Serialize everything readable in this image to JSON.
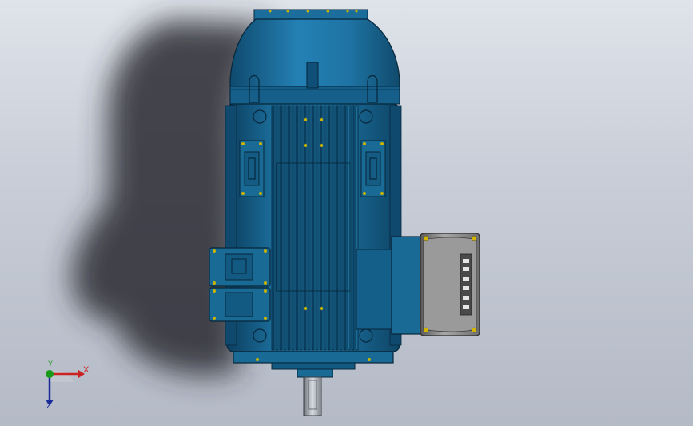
{
  "viewport": {
    "background_top": "#dfe3ea",
    "background_bottom": "#b4bac6"
  },
  "model": {
    "body_color": "#1a6a96",
    "body_dark": "#0d3f5e",
    "terminal_box_color": "#8a8a8a"
  },
  "triad": {
    "x_label": "X",
    "y_label": "Y",
    "z_label": "Z",
    "x_color": "#cc2222",
    "y_color": "#1a9a1a",
    "z_color": "#1a2a9a"
  }
}
